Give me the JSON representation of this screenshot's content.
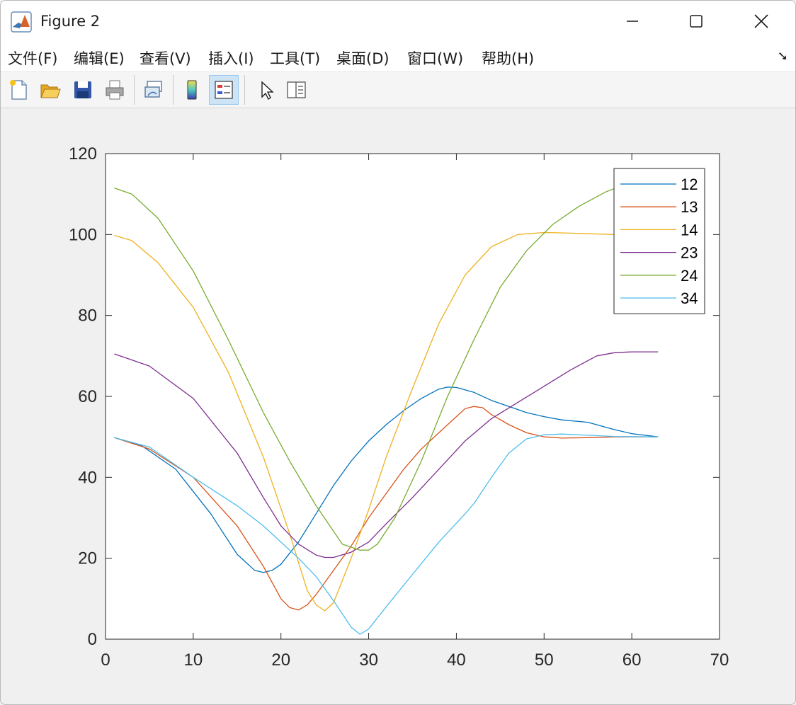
{
  "window": {
    "title": "Figure 2",
    "controls": {
      "minimize": "—",
      "maximize": "☐",
      "close": "✕"
    }
  },
  "menu": {
    "items": [
      "文件(F)",
      "编辑(E)",
      "查看(V)",
      "插入(I)",
      "工具(T)",
      "桌面(D)",
      "窗口(W)",
      "帮助(H)"
    ],
    "overflow_icon": "dock-arrow-icon"
  },
  "toolbar": {
    "buttons": [
      {
        "name": "new-figure",
        "icon": "new-file-icon"
      },
      {
        "name": "open-file",
        "icon": "folder-open-icon"
      },
      {
        "name": "save",
        "icon": "save-disk-icon"
      },
      {
        "name": "print",
        "icon": "printer-icon"
      },
      {
        "name": "link-plot",
        "icon": "link-plot-icon"
      },
      {
        "name": "insert-colorbar",
        "icon": "colorbar-icon"
      },
      {
        "name": "insert-legend",
        "icon": "legend-icon",
        "active": true
      },
      {
        "name": "edit-plot",
        "icon": "pointer-arrow-icon"
      },
      {
        "name": "property-inspector",
        "icon": "property-panel-icon"
      }
    ]
  },
  "chart_data": {
    "type": "line",
    "xlim": [
      0,
      70
    ],
    "ylim": [
      0,
      120
    ],
    "xticks": [
      0,
      10,
      20,
      30,
      40,
      50,
      60,
      70
    ],
    "yticks": [
      0,
      20,
      40,
      60,
      80,
      100,
      120
    ],
    "legend_position": "top-right",
    "grid": false,
    "series": [
      {
        "name": "12",
        "color": "#0072bd",
        "x": [
          1,
          4,
          8,
          12,
          15,
          17,
          18,
          19,
          20,
          22,
          24,
          26,
          28,
          30,
          32,
          34,
          36,
          38,
          39,
          40,
          42,
          44,
          46,
          48,
          50,
          52,
          55,
          58,
          60,
          63
        ],
        "y": [
          49.8,
          48,
          42,
          31,
          21,
          17,
          16.5,
          17,
          18.5,
          24,
          31,
          38,
          44,
          49,
          53,
          56.5,
          59.5,
          61.8,
          62.3,
          62.2,
          61,
          59,
          57.5,
          56,
          55,
          54.2,
          53.6,
          51.8,
          50.8,
          50
        ]
      },
      {
        "name": "13",
        "color": "#d95319",
        "x": [
          1,
          5,
          10,
          15,
          18,
          20,
          21,
          22,
          23,
          24,
          26,
          28,
          30,
          32,
          34,
          36,
          38,
          40,
          41,
          42,
          43,
          44,
          46,
          48,
          50,
          52,
          55,
          58,
          63
        ],
        "y": [
          49.8,
          47,
          40,
          28,
          18,
          10,
          7.8,
          7.2,
          8.5,
          11,
          17,
          23,
          30,
          36,
          42,
          47,
          51,
          55,
          57,
          57.5,
          57.2,
          55.5,
          53,
          51,
          50,
          49.7,
          49.8,
          50,
          50
        ]
      },
      {
        "name": "14",
        "color": "#edb120",
        "x": [
          1,
          3,
          6,
          10,
          14,
          18,
          21,
          23,
          24,
          25,
          26,
          28,
          30,
          32,
          35,
          38,
          41,
          44,
          47,
          50,
          52,
          55,
          58,
          60,
          63
        ],
        "y": [
          99.8,
          98.5,
          93,
          82,
          66,
          45,
          26,
          12,
          8.5,
          7,
          9,
          20,
          32,
          45,
          62,
          78,
          90,
          97,
          100,
          100.5,
          100.4,
          100.2,
          100,
          99.9,
          100
        ]
      },
      {
        "name": "23",
        "color": "#7e2f8e",
        "x": [
          1,
          5,
          10,
          15,
          18,
          20,
          22,
          24,
          25,
          26,
          28,
          30,
          32,
          35,
          38,
          41,
          44,
          47,
          50,
          53,
          56,
          58,
          60,
          63
        ],
        "y": [
          70.5,
          67.5,
          59.5,
          46,
          35,
          28,
          23.5,
          20.8,
          20.2,
          20.2,
          21.5,
          24,
          28.5,
          35,
          42,
          49,
          54.5,
          58.5,
          62.5,
          66.5,
          70,
          70.8,
          71,
          71
        ]
      },
      {
        "name": "24",
        "color": "#77ac30",
        "x": [
          1,
          3,
          6,
          10,
          14,
          18,
          21,
          24,
          27,
          29,
          30,
          31,
          33,
          36,
          39,
          42,
          45,
          48,
          51,
          54,
          57,
          60,
          63
        ],
        "y": [
          111.5,
          110,
          104,
          91,
          74,
          56,
          44,
          33,
          23.5,
          22,
          22,
          23.5,
          30,
          44,
          60,
          74,
          87,
          96,
          102.5,
          107,
          110.5,
          113,
          114.5
        ]
      },
      {
        "name": "34",
        "color": "#4dbeee",
        "x": [
          1,
          5,
          10,
          15,
          18,
          20,
          22,
          24,
          26,
          28,
          29,
          30,
          32,
          35,
          38,
          41,
          42,
          44,
          46,
          48,
          50,
          52,
          55,
          58,
          63
        ],
        "y": [
          49.8,
          47.5,
          40,
          33,
          28,
          24,
          20,
          15.5,
          9.5,
          3,
          1.2,
          2.5,
          8,
          16,
          24,
          31,
          33.5,
          40,
          46,
          49.5,
          50.5,
          50.7,
          50.4,
          50.1,
          50
        ]
      }
    ]
  }
}
